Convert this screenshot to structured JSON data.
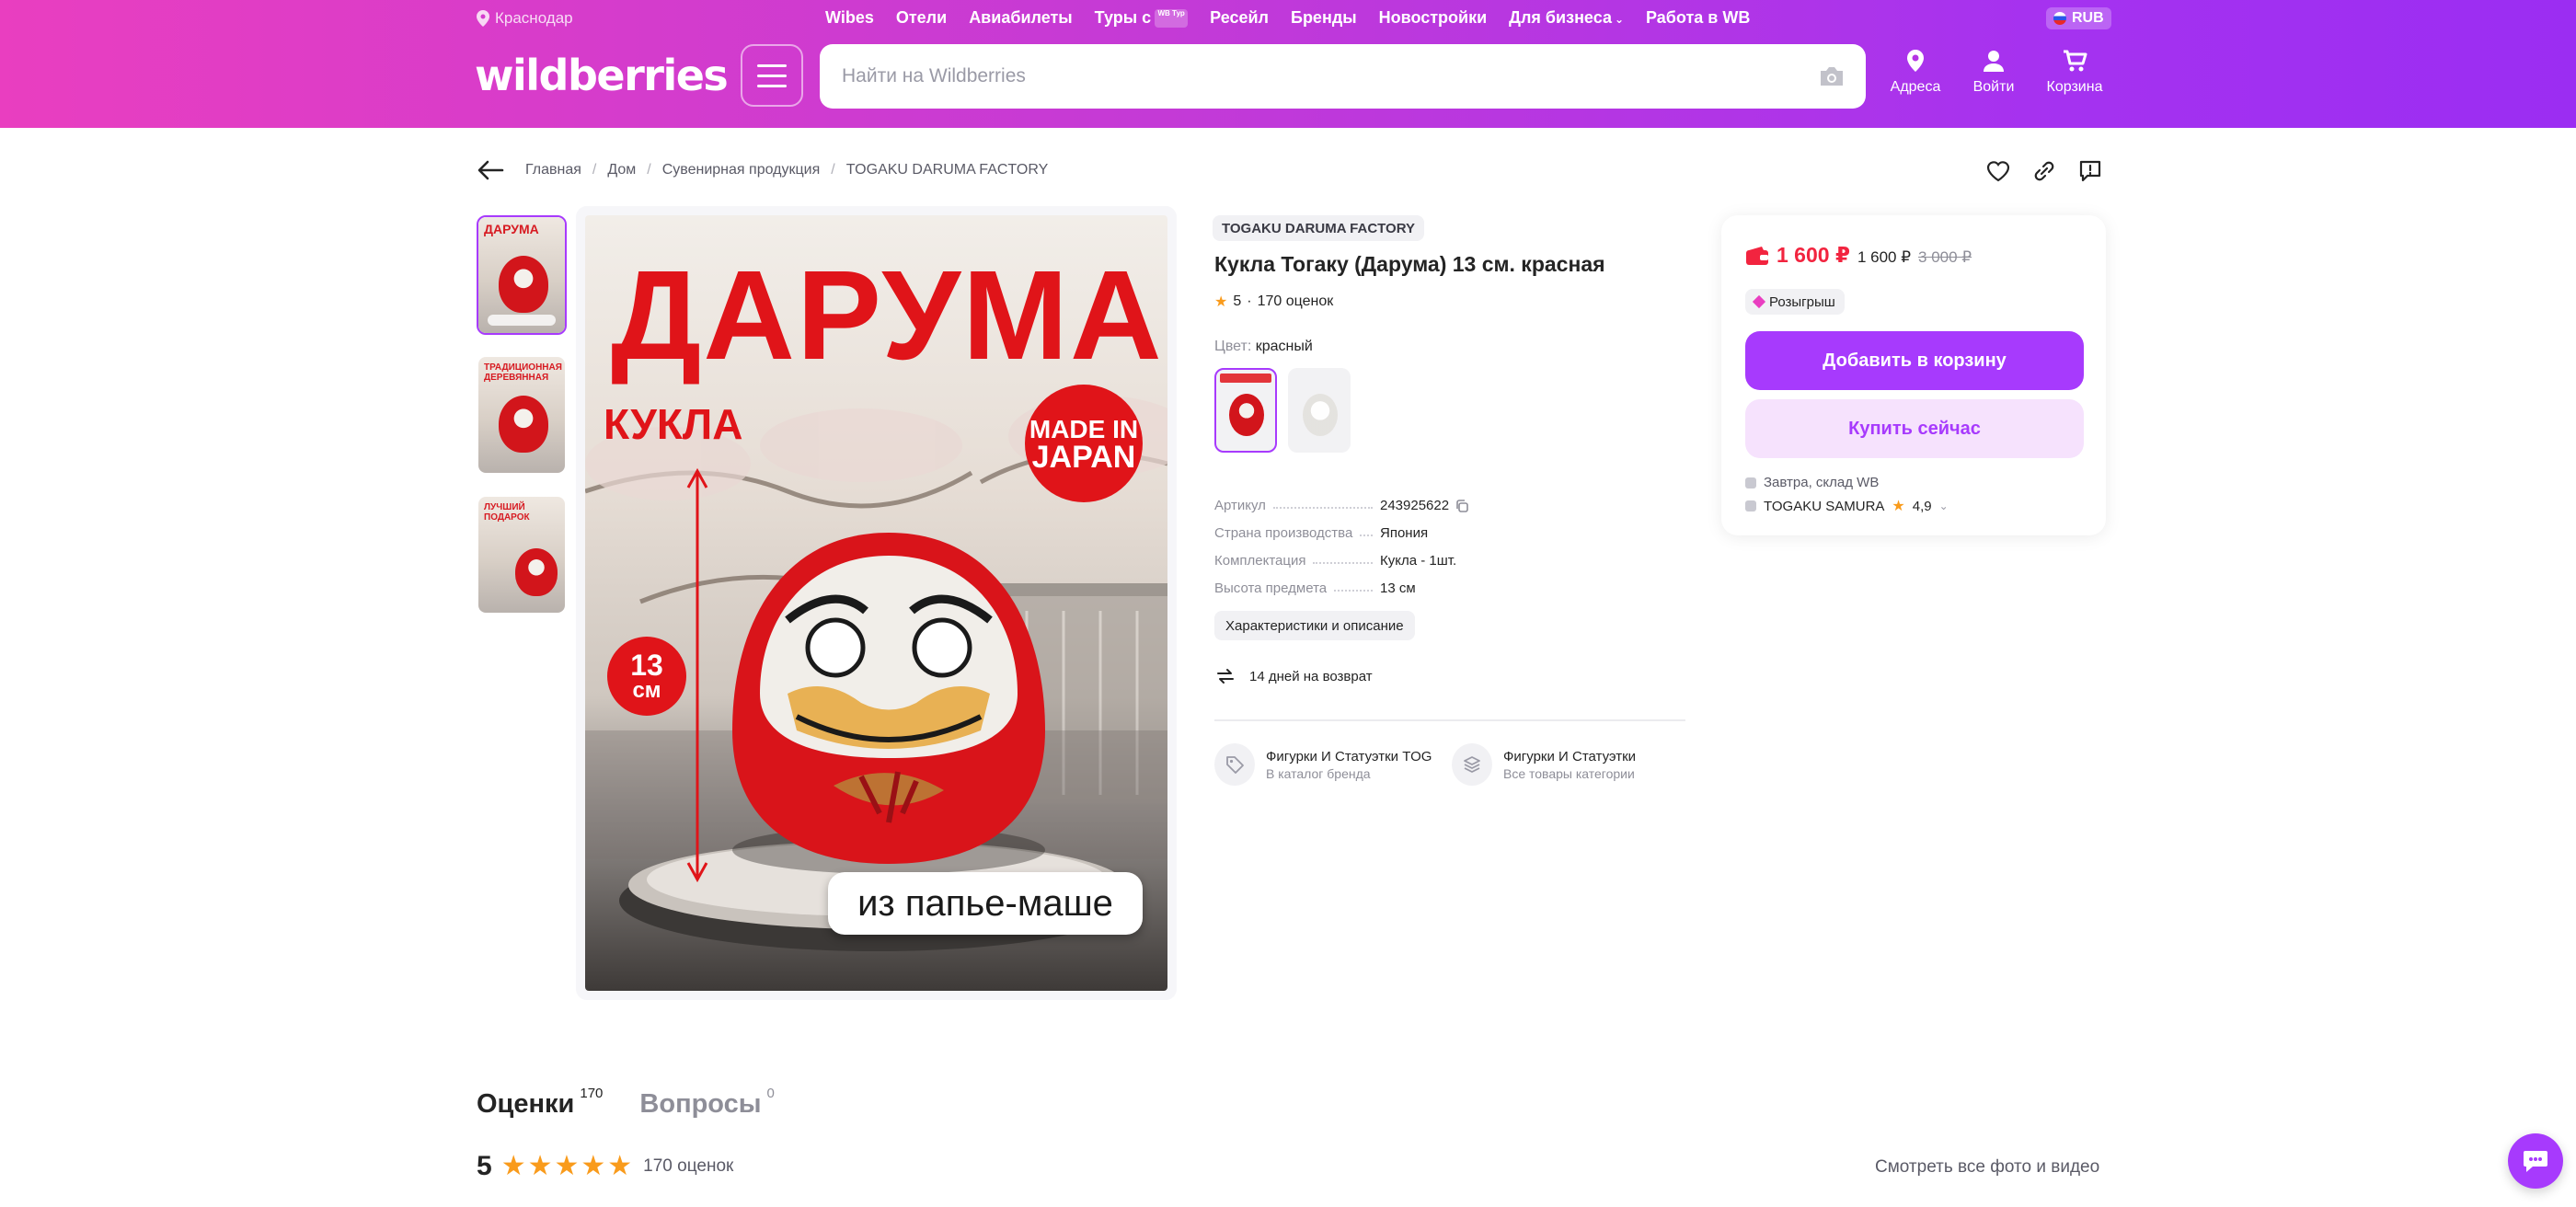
{
  "header": {
    "city": "Краснодар",
    "nav": [
      "Wibes",
      "Отели",
      "Авиабилеты",
      "Туры с",
      "Ресейл",
      "Бренды",
      "Новостройки",
      "Для бизнеса",
      "Работа в WB"
    ],
    "tours_badge": "WB Тур",
    "currency": "RUB",
    "logo": "wildberries",
    "search_placeholder": "Найти на Wildberries",
    "icons": [
      {
        "label": "Адреса",
        "icon": "location-pin-icon"
      },
      {
        "label": "Войти",
        "icon": "user-icon"
      },
      {
        "label": "Корзина",
        "icon": "cart-icon"
      }
    ],
    "accent_gradient": [
      "#e93ec0",
      "#9b2df2"
    ]
  },
  "breadcrumbs": [
    "Главная",
    "Дом",
    "Сувенирная продукция",
    "TOGAKU DARUMA FACTORY"
  ],
  "gallery": {
    "thumbs": [
      {
        "title": "ДАРУМА"
      },
      {
        "title": "ТРАДИЦИОННАЯ ДЕРЕВЯННАЯ"
      },
      {
        "title": "ЛУЧШИЙ ПОДАРОК"
      }
    ],
    "main": {
      "title": "ДАРУМА",
      "subtitle": "КУКЛА",
      "badge": "MADE IN JAPAN",
      "badge_line1": "MADE IN",
      "badge_line2": "JAPAN",
      "size_num": "13",
      "size_unit": "см",
      "material": "из папье-маше"
    }
  },
  "product": {
    "brand": "TOGAKU DARUMA FACTORY",
    "title": "Кукла Тогаку (Дарума) 13 см. красная",
    "rating": "5",
    "reviews": "170 оценок",
    "color_label": "Цвет:",
    "color_value": "красный",
    "specs": [
      {
        "key": "Артикул",
        "value": "243925622"
      },
      {
        "key": "Страна производства",
        "value": "Япония"
      },
      {
        "key": "Комплектация",
        "value": "Кукла - 1шт."
      },
      {
        "key": "Высота предмета",
        "value": "13 см"
      }
    ],
    "chars_link": "Характеристики и описание",
    "returns": "14 дней на возврат",
    "links": [
      {
        "title": "Фигурки И Статуэтки TOGAKU",
        "sub": "В каталог бренда",
        "icon": "tag-icon"
      },
      {
        "title": "Фигурки И Статуэтки",
        "sub": "Все товары категории",
        "icon": "stack-icon"
      }
    ]
  },
  "buybox": {
    "price": "1 600 ₽",
    "price_alt": "1 600 ₽",
    "old_price": "3 000 ₽",
    "raffle": "Розыгрыш",
    "add_to_cart": "Добавить в корзину",
    "buy_now": "Купить сейчас",
    "delivery": "Завтра, склад WB",
    "seller": "TOGAKU SAMURA",
    "seller_rating": "4,9",
    "price_color": "#f2243f",
    "button_color": "#a73afd"
  },
  "reviews": {
    "tab_reviews": "Оценки",
    "tab_reviews_count": "170",
    "tab_questions": "Вопросы",
    "tab_questions_count": "0",
    "score": "5",
    "count": "170 оценок",
    "see_all": "Смотреть все фото и видео",
    "stars": 5
  }
}
